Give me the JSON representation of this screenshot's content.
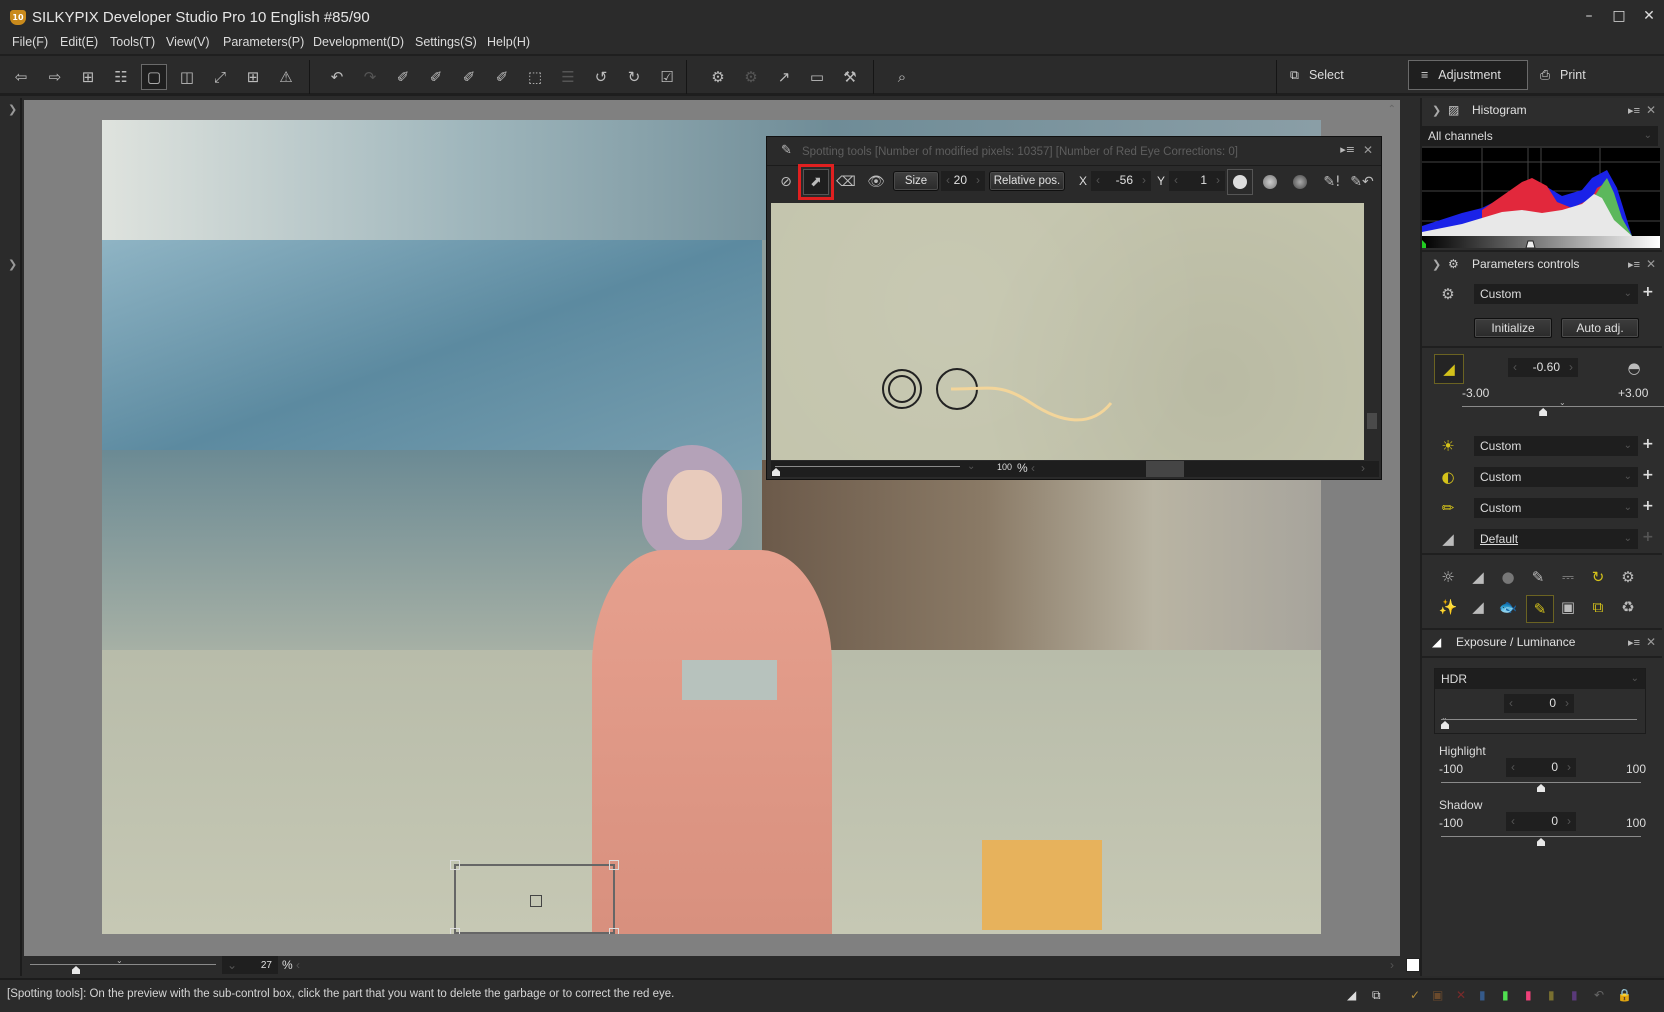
{
  "window": {
    "title": "SILKYPIX Developer Studio Pro 10 English   #85/90",
    "logo_text": "10",
    "controls": {
      "minimize": "–",
      "maximize": "□",
      "close": "✕"
    }
  },
  "menu": [
    {
      "label": "File(F)"
    },
    {
      "label": "Edit(E)"
    },
    {
      "label": "Tools(T)"
    },
    {
      "label": "View(V)"
    },
    {
      "label": "Parameters(P)"
    },
    {
      "label": "Development(D)"
    },
    {
      "label": "Settings(S)"
    },
    {
      "label": "Help(H)"
    }
  ],
  "toolbar": {
    "icons": [
      {
        "name": "previous-image-icon",
        "glyph": "⇦"
      },
      {
        "name": "next-image-icon",
        "glyph": "⇨"
      },
      {
        "name": "thumbnail-view-icon",
        "glyph": "⊞"
      },
      {
        "name": "filmstrip-view-icon",
        "glyph": "☷"
      },
      {
        "name": "single-preview-icon",
        "glyph": "▢",
        "active": true
      },
      {
        "name": "compare-view-icon",
        "glyph": "◫"
      },
      {
        "name": "fullscreen-icon",
        "glyph": "⤢"
      },
      {
        "name": "grid-guide-icon",
        "glyph": "⊞"
      },
      {
        "name": "warning-icon",
        "glyph": "⚠"
      },
      {
        "name": "undo-icon",
        "glyph": "↶"
      },
      {
        "name": "redo-icon",
        "glyph": "↷",
        "dim": true
      },
      {
        "name": "exposure-picker-icon",
        "glyph": "✐"
      },
      {
        "name": "gray-picker-icon",
        "glyph": "✐"
      },
      {
        "name": "black-white-picker-icon",
        "glyph": "✐"
      },
      {
        "name": "film-picker-icon",
        "glyph": "✐"
      },
      {
        "name": "transform-icon",
        "glyph": "⬚"
      },
      {
        "name": "layers-icon",
        "glyph": "☰",
        "dim": true
      },
      {
        "name": "rotate-left-icon",
        "glyph": "↺"
      },
      {
        "name": "rotate-right-icon",
        "glyph": "↻"
      },
      {
        "name": "mark-checked-icon",
        "glyph": "☑"
      },
      {
        "name": "save-parameters-icon",
        "glyph": "⚙"
      },
      {
        "name": "apply-parameters-icon",
        "glyph": "⚙",
        "dim": true
      },
      {
        "name": "export-icon",
        "glyph": "↗"
      },
      {
        "name": "monitor-icon",
        "glyph": "▭"
      },
      {
        "name": "develop-hammer-icon",
        "glyph": "⚒"
      },
      {
        "name": "zoom-search-icon",
        "glyph": "⌕"
      }
    ],
    "modes": [
      {
        "label": "Select",
        "icon": "⧉"
      },
      {
        "label": "Adjustment",
        "icon": "≡",
        "active": true
      },
      {
        "label": "Print",
        "icon": "⎙"
      }
    ]
  },
  "viewer": {
    "zoom_value": "27",
    "zoom_unit": "%"
  },
  "spotting_tools": {
    "title": "Spotting tools [Number of modified pixels: 10357]  [Number of Red Eye Corrections: 0]",
    "size_label": "Size",
    "size_value": "20",
    "relative_pos_label": "Relative pos.",
    "x_label": "X",
    "x_value": "-56",
    "y_label": "Y",
    "y_value": "1",
    "zoom_value": "100",
    "zoom_unit": "%"
  },
  "right_panel": {
    "histogram": {
      "title": "Histogram",
      "channel": "All channels"
    },
    "parameters_controls": {
      "title": "Parameters controls",
      "preset": "Custom",
      "initialize_label": "Initialize",
      "auto_adj_label": "Auto adj.",
      "exposure_value": "-0.60",
      "exposure_min": "-3.00",
      "exposure_max": "+3.00",
      "exposure_fraction": 0.4,
      "rows": [
        {
          "name": "white-balance",
          "value": "Custom"
        },
        {
          "name": "tone",
          "value": "Custom"
        },
        {
          "name": "sharpness",
          "value": "Custom"
        },
        {
          "name": "noise-reduction",
          "value": "Default"
        }
      ]
    },
    "exposure_luminance": {
      "title": "Exposure / Luminance",
      "hdr_label": "HDR",
      "hdr_value": "0",
      "highlight_label": "Highlight",
      "highlight_min": "-100",
      "highlight_max": "100",
      "highlight_value": "0",
      "shadow_label": "Shadow",
      "shadow_min": "-100",
      "shadow_max": "100",
      "shadow_value": "0"
    }
  },
  "status": {
    "text": "[Spotting tools]: On the preview with the sub-control box, click the part that you want to delete the garbage or to correct the red eye."
  }
}
